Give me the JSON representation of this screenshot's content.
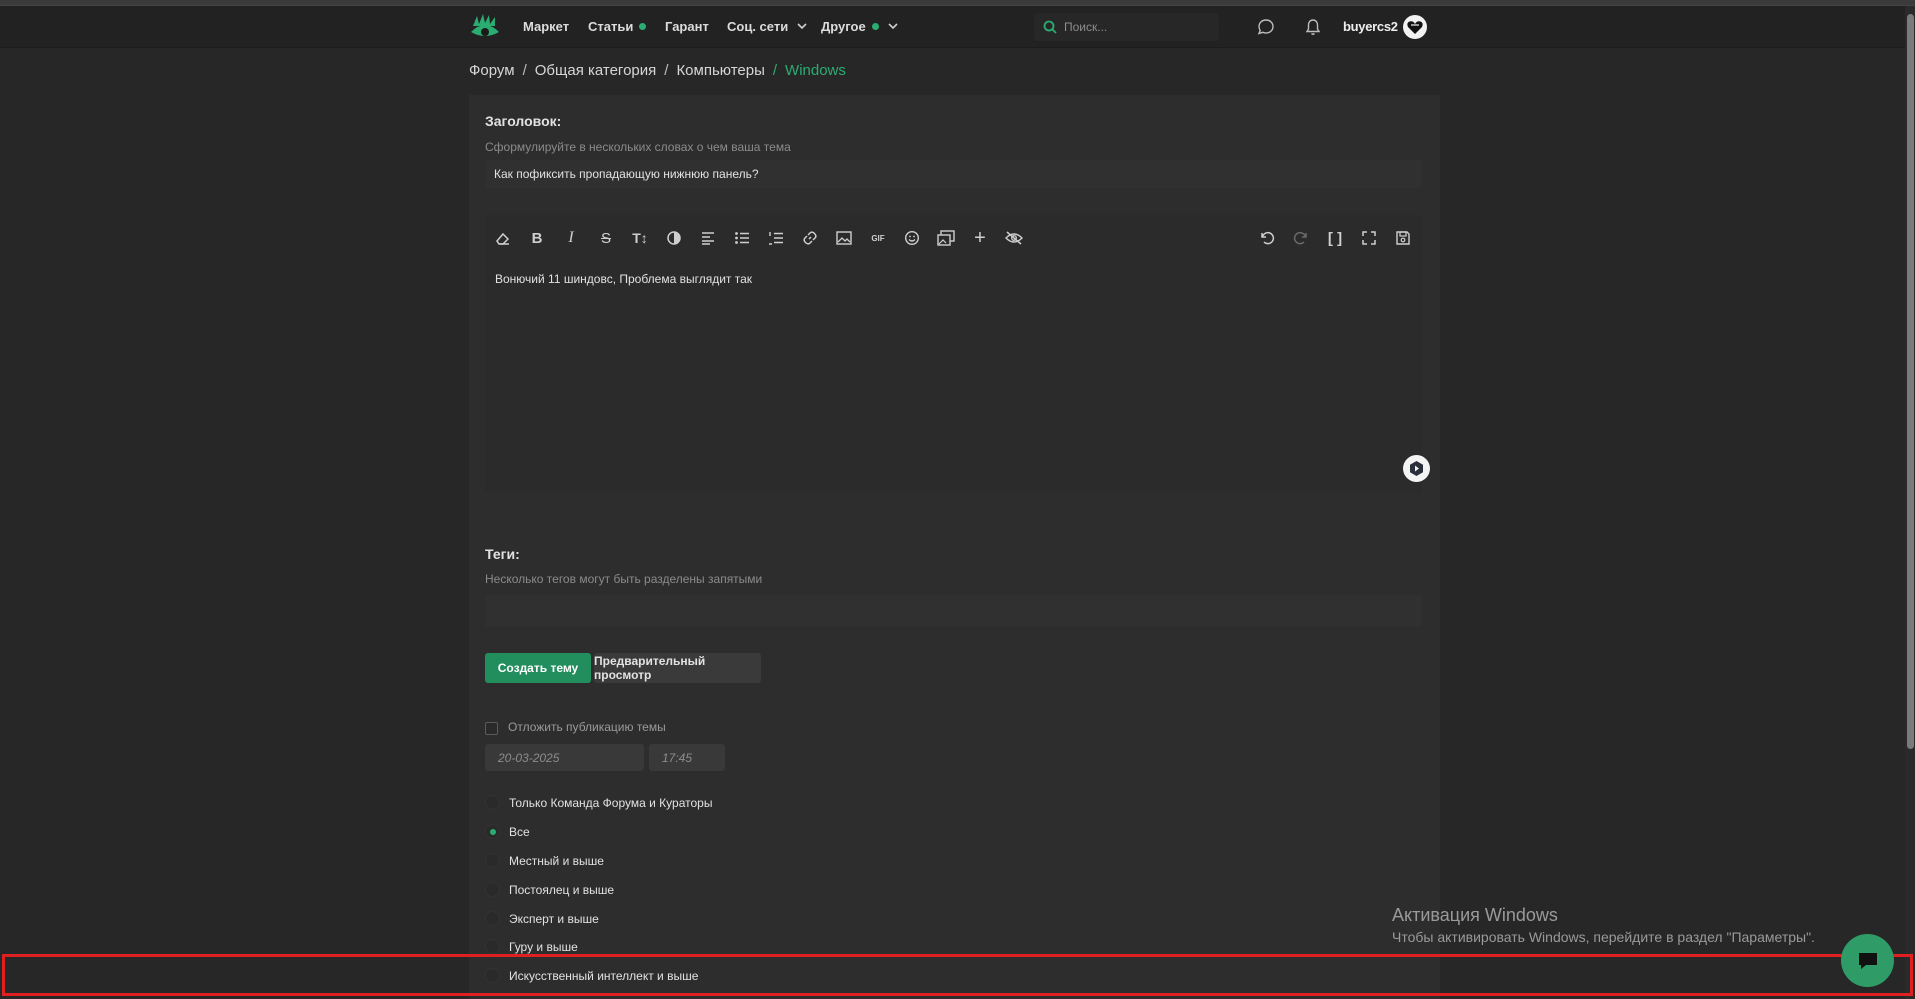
{
  "nav": {
    "items": [
      {
        "label": "Маркет",
        "has_dot": false,
        "has_dropdown": false
      },
      {
        "label": "Статьи",
        "has_dot": true,
        "has_dropdown": false
      },
      {
        "label": "Гарант",
        "has_dot": false,
        "has_dropdown": false
      },
      {
        "label": "Соц. сети",
        "has_dot": false,
        "has_dropdown": true
      },
      {
        "label": "Другое",
        "has_dot": true,
        "has_dropdown": true
      }
    ],
    "search_placeholder": "Поиск...",
    "username": "buyercs2",
    "logo_icon": "eye-logo-icon"
  },
  "breadcrumb": [
    "Форум",
    "Общая категория",
    "Компьютеры",
    "Windows"
  ],
  "form": {
    "title_label": "Заголовок:",
    "title_hint": "Сформулируйте в нескольких словах о чем ваша тема",
    "title_value": "Как пофиксить пропадающую нижнюю панель?",
    "editor_text": "Вонючий 11 шиндовс, Проблема выглядит так",
    "toolbar_icons": [
      "eraser-icon",
      "bold-icon",
      "italic-icon",
      "strikethrough-icon",
      "text-size-icon",
      "color-icon",
      "align-icon",
      "bullet-list-icon",
      "numbered-list-icon",
      "link-icon",
      "image-icon",
      "gif-icon",
      "emoji-icon",
      "gallery-icon",
      "plus-icon",
      "hide-icon"
    ],
    "toolbar_right_icons": [
      "undo-icon",
      "redo-icon",
      "brackets-icon",
      "fullscreen-icon",
      "save-draft-icon"
    ],
    "gif_label": "GIF",
    "tags_label": "Теги:",
    "tags_hint": "Несколько тегов могут быть разделены запятыми",
    "create_button": "Создать тему",
    "preview_button": "Предварительный просмотр",
    "delay_label": "Отложить публикацию темы",
    "date_value": "20-03-2025",
    "time_value": "17:45",
    "visibility_options": [
      {
        "label": "Только Команда Форума и Кураторы",
        "selected": false
      },
      {
        "label": "Все",
        "selected": true
      },
      {
        "label": "Местный и выше",
        "selected": false
      },
      {
        "label": "Постоялец и выше",
        "selected": false
      },
      {
        "label": "Эксперт и выше",
        "selected": false
      },
      {
        "label": "Гуру и выше",
        "selected": false
      },
      {
        "label": "Искусственный интеллект и выше",
        "selected": false
      }
    ]
  },
  "watermark": {
    "title": "Активация Windows",
    "subtitle": "Чтобы активировать Windows, перейдите в раздел \"Параметры\"."
  },
  "colors": {
    "accent": "#2bad72",
    "button": "#228e5d",
    "highlight": "#e02020"
  }
}
